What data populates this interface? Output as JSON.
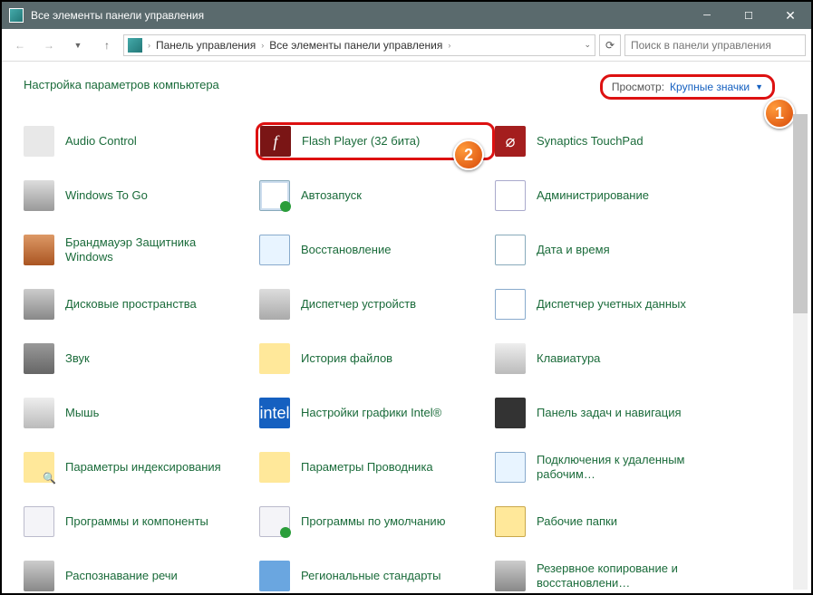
{
  "window": {
    "title": "Все элементы панели управления"
  },
  "nav": {
    "breadcrumb1": "Панель управления",
    "breadcrumb2": "Все элементы панели управления",
    "search_placeholder": "Поиск в панели управления"
  },
  "page": {
    "heading": "Настройка параметров компьютера",
    "view_label": "Просмотр:",
    "view_value": "Крупные значки"
  },
  "annotations": {
    "badge1": "1",
    "badge2": "2"
  },
  "items": [
    {
      "label": "Audio Control",
      "cls": "i-audio"
    },
    {
      "label": "Flash Player (32 бита)",
      "cls": "i-flash",
      "glyph": "f",
      "hl": true
    },
    {
      "label": "Synaptics TouchPad",
      "cls": "i-syn",
      "glyph": "⌀"
    },
    {
      "label": "Windows To Go",
      "cls": "i-usb"
    },
    {
      "label": "Автозапуск",
      "cls": "i-auto"
    },
    {
      "label": "Администрирование",
      "cls": "i-admin"
    },
    {
      "label": "Брандмауэр Защитника Windows",
      "cls": "i-fire"
    },
    {
      "label": "Восстановление",
      "cls": "i-restore"
    },
    {
      "label": "Дата и время",
      "cls": "i-date"
    },
    {
      "label": "Дисковые пространства",
      "cls": "i-disk"
    },
    {
      "label": "Диспетчер устройств",
      "cls": "i-dev"
    },
    {
      "label": "Диспетчер учетных данных",
      "cls": "i-acc"
    },
    {
      "label": "Звук",
      "cls": "i-sound"
    },
    {
      "label": "История файлов",
      "cls": "i-hist"
    },
    {
      "label": "Клавиатура",
      "cls": "i-kb"
    },
    {
      "label": "Мышь",
      "cls": "i-mouse"
    },
    {
      "label": "Настройки графики Intel®",
      "cls": "i-intel",
      "glyph": "intel"
    },
    {
      "label": "Панель задач и навигация",
      "cls": "i-task"
    },
    {
      "label": "Параметры индексирования",
      "cls": "i-idx"
    },
    {
      "label": "Параметры Проводника",
      "cls": "i-expl"
    },
    {
      "label": "Подключения к удаленным рабочим…",
      "cls": "i-rdp"
    },
    {
      "label": "Программы и компоненты",
      "cls": "i-prog"
    },
    {
      "label": "Программы по умолчанию",
      "cls": "i-def"
    },
    {
      "label": "Рабочие папки",
      "cls": "i-wf"
    },
    {
      "label": "Распознавание речи",
      "cls": "i-mic"
    },
    {
      "label": "Региональные стандарты",
      "cls": "i-reg"
    },
    {
      "label": "Резервное копирование и восстановлени…",
      "cls": "i-bak"
    }
  ]
}
